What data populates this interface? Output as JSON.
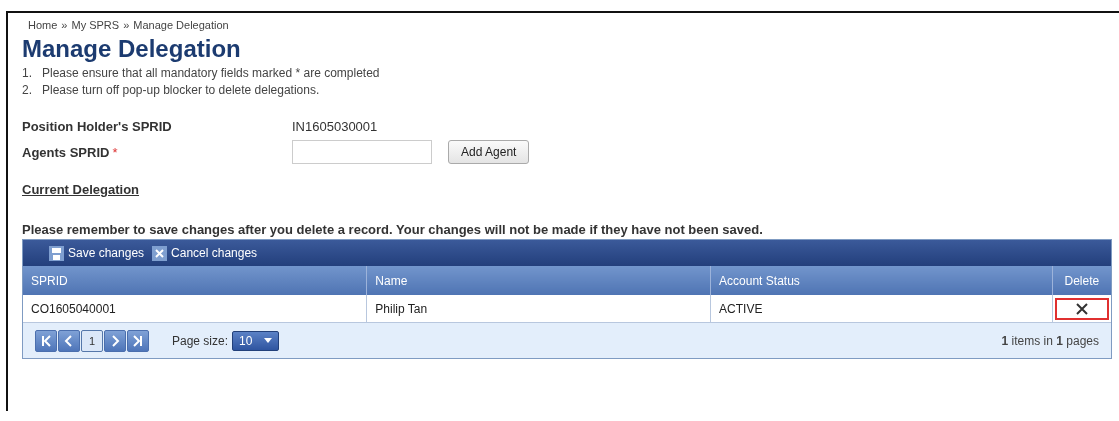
{
  "breadcrumb": [
    "Home",
    "My SPRS",
    "Manage Delegation"
  ],
  "breadcrumb_separator": "»",
  "title": "Manage Delegation",
  "instructions": [
    {
      "number": "1.",
      "text": "Please ensure that all mandatory fields marked * are completed"
    },
    {
      "number": "2.",
      "text": "Please turn off pop-up blocker to delete delegations."
    }
  ],
  "position_holder": {
    "label": "Position Holder's SPRID",
    "value": "IN1605030001"
  },
  "agent_field": {
    "label": "Agents SPRID",
    "required_mark": "*",
    "button": "Add Agent"
  },
  "section_title": "Current Delegation",
  "notice": "Please remember to save changes after you delete a record. Your changes will not be made if they have not been saved.",
  "toolbar": [
    {
      "kind": "save",
      "label": "Save changes"
    },
    {
      "kind": "cancel",
      "label": "Cancel changes"
    }
  ],
  "table": {
    "columns": [
      "SPRID",
      "Name",
      "Account Status",
      "Delete"
    ],
    "rows": [
      {
        "sprid": "CO1605040001",
        "name": "Philip Tan",
        "status": "ACTIVE",
        "delete_highlighted": true
      }
    ]
  },
  "pager": {
    "pages": [
      {
        "label": "1",
        "selected": true
      }
    ],
    "page_size_label": "Page size:",
    "page_size": "10",
    "summary": "**1** items in **1** pages"
  }
}
